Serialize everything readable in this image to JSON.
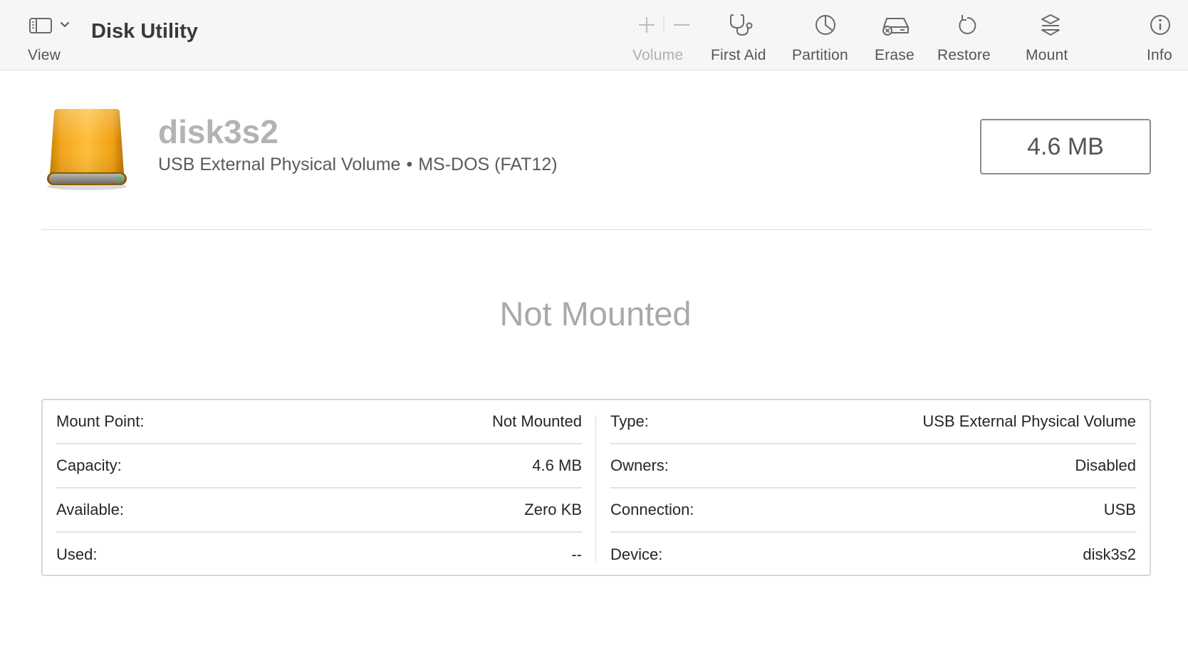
{
  "app": {
    "title": "Disk Utility"
  },
  "toolbar": {
    "view_label": "View",
    "volume_label": "Volume",
    "first_aid_label": "First Aid",
    "partition_label": "Partition",
    "erase_label": "Erase",
    "restore_label": "Restore",
    "mount_label": "Mount",
    "info_label": "Info"
  },
  "volume": {
    "name": "disk3s2",
    "type": "USB External Physical Volume",
    "separator": "•",
    "format": "MS-DOS (FAT12)",
    "size": "4.6 MB",
    "state": "Not Mounted"
  },
  "details": {
    "left": [
      {
        "key": "Mount Point:",
        "value": "Not Mounted"
      },
      {
        "key": "Capacity:",
        "value": "4.6 MB"
      },
      {
        "key": "Available:",
        "value": "Zero KB"
      },
      {
        "key": "Used:",
        "value": "--"
      }
    ],
    "right": [
      {
        "key": "Type:",
        "value": "USB External Physical Volume"
      },
      {
        "key": "Owners:",
        "value": "Disabled"
      },
      {
        "key": "Connection:",
        "value": "USB"
      },
      {
        "key": "Device:",
        "value": "disk3s2"
      }
    ]
  },
  "colors": {
    "toolbar_bg": "#f6f6f6",
    "disk_orange": "#f5a623",
    "muted_text": "#a9a9a9"
  }
}
